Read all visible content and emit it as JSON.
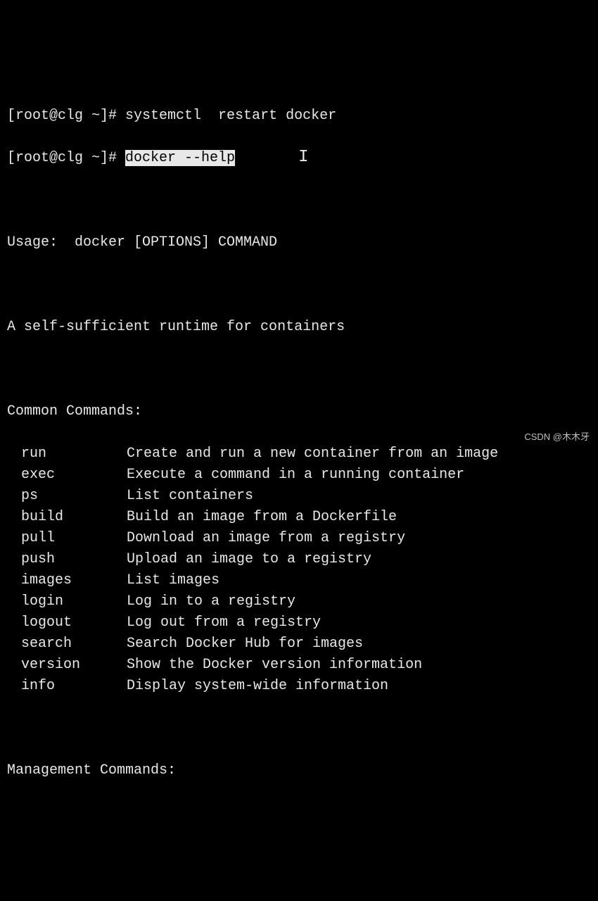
{
  "prompt1": {
    "prefix": "[root@clg ~]# ",
    "command": "systemctl  restart docker"
  },
  "prompt2": {
    "prefix": "[root@clg ~]# ",
    "command": "docker --help",
    "cursor_glyph": "I"
  },
  "usage_line": "Usage:  docker [OPTIONS] COMMAND",
  "description": "A self-sufficient runtime for containers",
  "common_header": "Common Commands:",
  "common_commands": [
    {
      "name": "run",
      "desc": "Create and run a new container from an image"
    },
    {
      "name": "exec",
      "desc": "Execute a command in a running container"
    },
    {
      "name": "ps",
      "desc": "List containers"
    },
    {
      "name": "build",
      "desc": "Build an image from a Dockerfile"
    },
    {
      "name": "pull",
      "desc": "Download an image from a registry"
    },
    {
      "name": "push",
      "desc": "Upload an image to a registry"
    },
    {
      "name": "images",
      "desc": "List images"
    },
    {
      "name": "login",
      "desc": "Log in to a registry"
    },
    {
      "name": "logout",
      "desc": "Log out from a registry"
    },
    {
      "name": "search",
      "desc": "Search Docker Hub for images"
    },
    {
      "name": "version",
      "desc": "Show the Docker version information"
    },
    {
      "name": "info",
      "desc": "Display system-wide information"
    }
  ],
  "management_header": "Management Commands:",
  "watermark": "CSDN @木木牙"
}
